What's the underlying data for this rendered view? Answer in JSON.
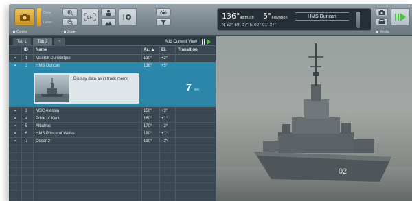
{
  "toolbar": {
    "color_label": "Color",
    "laser_label": "Laser",
    "control_label": "Control",
    "zoom_label": "Zoom",
    "media_label": "Media"
  },
  "azimuth": {
    "azimuth_value": "136°",
    "azimuth_unit": "azimuth",
    "elevation_value": "5°",
    "elevation_unit": "elevation",
    "target_name": "HMS Duncan",
    "coordinates": "N  50° 59' 07\"   E  02° 01' 37\""
  },
  "tabs": [
    {
      "label": "Tab 1"
    },
    {
      "label": "Tab 2"
    },
    {
      "label": "+"
    }
  ],
  "add_view_label": "Add Current View",
  "table": {
    "headers": {
      "id": "ID",
      "name": "Name",
      "az": "Az.  ▲",
      "el": "El.",
      "transition": "Transition"
    },
    "rows": [
      {
        "id": "1",
        "name": "Maersk Dunkerque",
        "az": "130°",
        "el": "+2°"
      },
      {
        "id": "2",
        "name": "HMS Duncan",
        "az": "136°",
        "el": "+5°"
      },
      {
        "id": "3",
        "name": "MSC Alessia",
        "az": "150°",
        "el": "+3°"
      },
      {
        "id": "4",
        "name": "Pride of Kent",
        "az": "160°",
        "el": "+1°"
      },
      {
        "id": "5",
        "name": "Albatros",
        "az": "170°",
        "el": "- 2°"
      },
      {
        "id": "6",
        "name": "HMS Prince of Wales",
        "az": "180°",
        "el": "+1°"
      },
      {
        "id": "7",
        "name": "Oscar 2",
        "az": "190°",
        "el": "- 3°"
      }
    ],
    "selected_detail": {
      "memo_text": "Display data as in track memo",
      "transition_value": "7",
      "transition_unit": "sec"
    }
  },
  "colors": {
    "selected_row": "#2c89ac",
    "play_green": "#45c83a",
    "toggle_yellow": "#f0b53a"
  }
}
